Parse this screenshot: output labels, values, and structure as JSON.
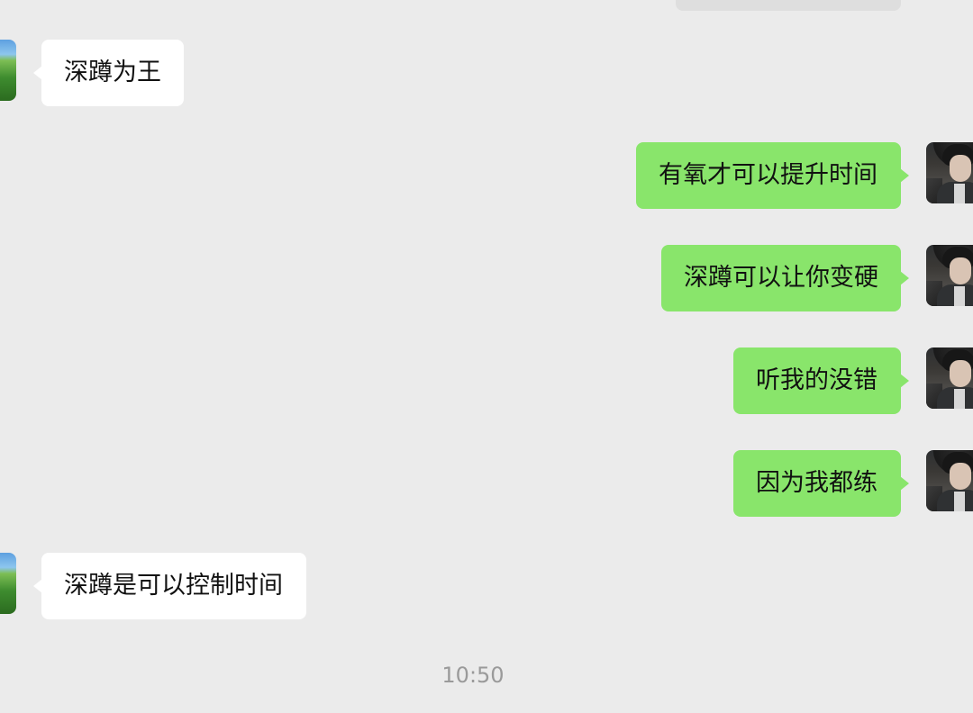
{
  "conversation": {
    "messages": [
      {
        "side": "left",
        "text": "深蹲为王",
        "avatar_icon": "landscape-avatar-icon"
      },
      {
        "side": "right",
        "text": "有氧才可以提升时间",
        "avatar_icon": "portrait-avatar-icon"
      },
      {
        "side": "right",
        "text": "深蹲可以让你变硬",
        "avatar_icon": "portrait-avatar-icon"
      },
      {
        "side": "right",
        "text": "听我的没错",
        "avatar_icon": "portrait-avatar-icon"
      },
      {
        "side": "right",
        "text": "因为我都练",
        "avatar_icon": "portrait-avatar-icon"
      },
      {
        "side": "left",
        "text": "深蹲是可以控制时间",
        "avatar_icon": "landscape-avatar-icon"
      }
    ],
    "timestamp": "10:50"
  },
  "colors": {
    "chat_background": "#ebebeb",
    "incoming_bubble": "#ffffff",
    "outgoing_bubble": "#89e56b",
    "timestamp_text": "#9a9a9a"
  }
}
